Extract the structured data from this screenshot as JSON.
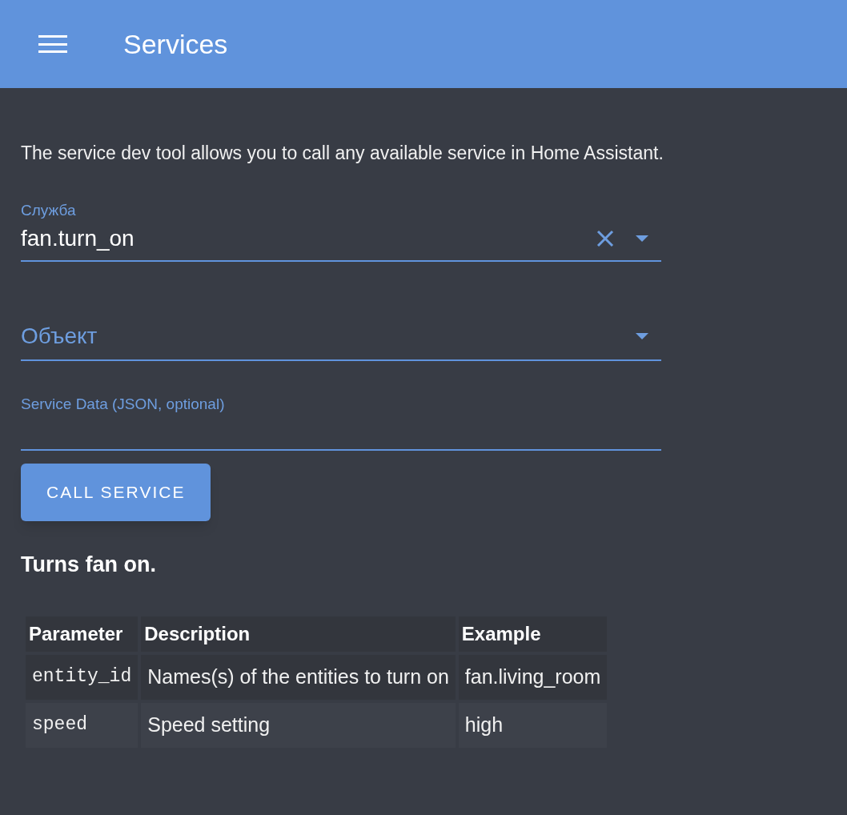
{
  "header": {
    "title": "Services"
  },
  "intro": "The service dev tool allows you to call any available service in Home Assistant.",
  "service_field": {
    "label": "Служба",
    "value": "fan.turn_on"
  },
  "entity_field": {
    "placeholder": "Объект"
  },
  "service_data_field": {
    "label": "Service Data (JSON, optional)"
  },
  "call_button": "CALL SERVICE",
  "description": "Turns fan on.",
  "table": {
    "columns": [
      "Parameter",
      "Description",
      "Example"
    ],
    "rows": [
      {
        "parameter": "entity_id",
        "description": "Names(s) of the entities to turn on",
        "example": "fan.living_room"
      },
      {
        "parameter": "speed",
        "description": "Speed setting",
        "example": "high"
      }
    ]
  }
}
